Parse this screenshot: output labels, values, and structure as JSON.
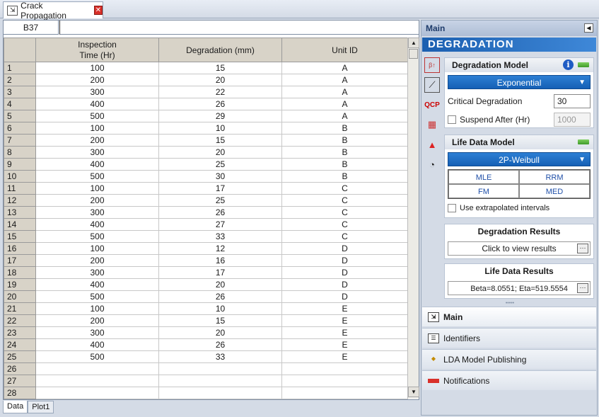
{
  "document_tab": {
    "title": "Crack Propagation"
  },
  "sheet": {
    "name_box": "B37",
    "formula_value": "",
    "columns": [
      "Inspection\nTime (Hr)",
      "Degradation (mm)",
      "Unit ID"
    ],
    "rows": [
      [
        "1",
        "100",
        "15",
        "A"
      ],
      [
        "2",
        "200",
        "20",
        "A"
      ],
      [
        "3",
        "300",
        "22",
        "A"
      ],
      [
        "4",
        "400",
        "26",
        "A"
      ],
      [
        "5",
        "500",
        "29",
        "A"
      ],
      [
        "6",
        "100",
        "10",
        "B"
      ],
      [
        "7",
        "200",
        "15",
        "B"
      ],
      [
        "8",
        "300",
        "20",
        "B"
      ],
      [
        "9",
        "400",
        "25",
        "B"
      ],
      [
        "10",
        "500",
        "30",
        "B"
      ],
      [
        "11",
        "100",
        "17",
        "C"
      ],
      [
        "12",
        "200",
        "25",
        "C"
      ],
      [
        "13",
        "300",
        "26",
        "C"
      ],
      [
        "14",
        "400",
        "27",
        "C"
      ],
      [
        "15",
        "500",
        "33",
        "C"
      ],
      [
        "16",
        "100",
        "12",
        "D"
      ],
      [
        "17",
        "200",
        "16",
        "D"
      ],
      [
        "18",
        "300",
        "17",
        "D"
      ],
      [
        "19",
        "400",
        "20",
        "D"
      ],
      [
        "20",
        "500",
        "26",
        "D"
      ],
      [
        "21",
        "100",
        "10",
        "E"
      ],
      [
        "22",
        "200",
        "15",
        "E"
      ],
      [
        "23",
        "300",
        "20",
        "E"
      ],
      [
        "24",
        "400",
        "26",
        "E"
      ],
      [
        "25",
        "500",
        "33",
        "E"
      ],
      [
        "26",
        "",
        "",
        ""
      ],
      [
        "27",
        "",
        "",
        ""
      ],
      [
        "28",
        "",
        "",
        ""
      ]
    ],
    "tabs": [
      "Data",
      "Plot1"
    ]
  },
  "panel": {
    "header": "Main",
    "banner": "DEGRADATION",
    "degradation_model": {
      "title": "Degradation Model",
      "model": "Exponential",
      "critical_label": "Critical Degradation",
      "critical_value": "30",
      "suspend_label": "Suspend After (Hr)",
      "suspend_value": "1000"
    },
    "life_model": {
      "title": "Life Data Model",
      "model": "2P-Weibull",
      "methods": [
        "MLE",
        "RRM",
        "FM",
        "MED"
      ],
      "extrapolate_label": "Use extrapolated intervals"
    },
    "degradation_results": {
      "title": "Degradation Results",
      "value": "Click to view results"
    },
    "life_results": {
      "title": "Life Data Results",
      "value": "Beta=8.0551; Eta=519.5554"
    },
    "nav": [
      "Main",
      "Identifiers",
      "LDA Model Publishing",
      "Notifications"
    ]
  },
  "colors": {
    "accent": "#1560b5",
    "green": "#3f9a2a",
    "close_red": "#d9302a"
  }
}
